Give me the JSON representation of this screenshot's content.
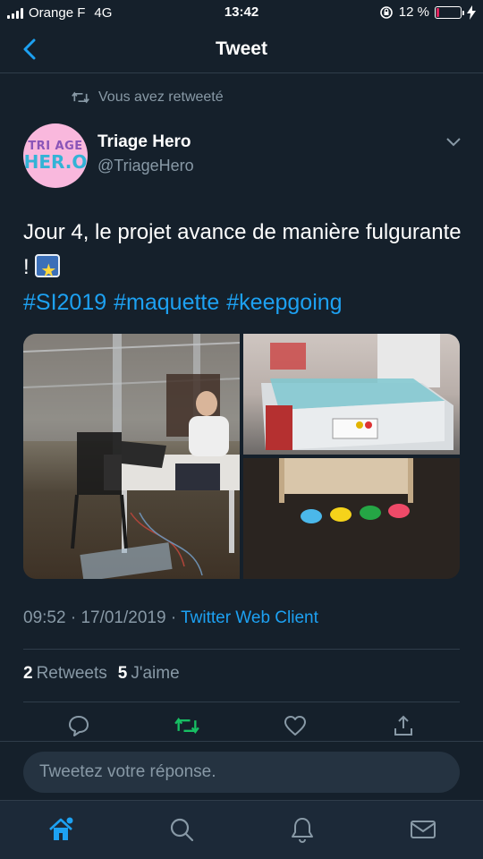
{
  "status_bar": {
    "carrier": "Orange F",
    "network": "4G",
    "time": "13:42",
    "battery_percent": "12 %",
    "battery_level": 0.12
  },
  "header": {
    "title": "Tweet"
  },
  "retweet_context": {
    "text": "Vous avez retweeté"
  },
  "author": {
    "name": "Triage Hero",
    "handle": "@TriageHero",
    "avatar_line1": "TRI AGE",
    "avatar_line2": "HER.O"
  },
  "tweet": {
    "text": "Jour 4, le projet avance de manière fulgurante !",
    "hashtags": [
      "#SI2019",
      "#maquette",
      "#keepgoing"
    ],
    "time": "09:52",
    "date": "17/01/2019",
    "client": "Twitter Web Client"
  },
  "stats": {
    "retweets_count": "2",
    "retweets_label": "Retweets",
    "likes_count": "5",
    "likes_label": "J'aime"
  },
  "reply": {
    "placeholder": "Tweetez votre réponse."
  },
  "colors": {
    "accent": "#1da1f2",
    "retweet_active": "#17bf63",
    "background": "#15202b",
    "secondary_text": "#8899a6"
  },
  "icons": {
    "back": "chevron-left-icon",
    "retweet_context": "retweet-icon",
    "menu": "chevron-down-icon",
    "reply": "comment-icon",
    "retweet": "retweet-icon",
    "like": "heart-icon",
    "share": "share-icon",
    "home": "home-icon",
    "search": "search-icon",
    "notifications": "bell-icon",
    "messages": "mail-icon"
  }
}
